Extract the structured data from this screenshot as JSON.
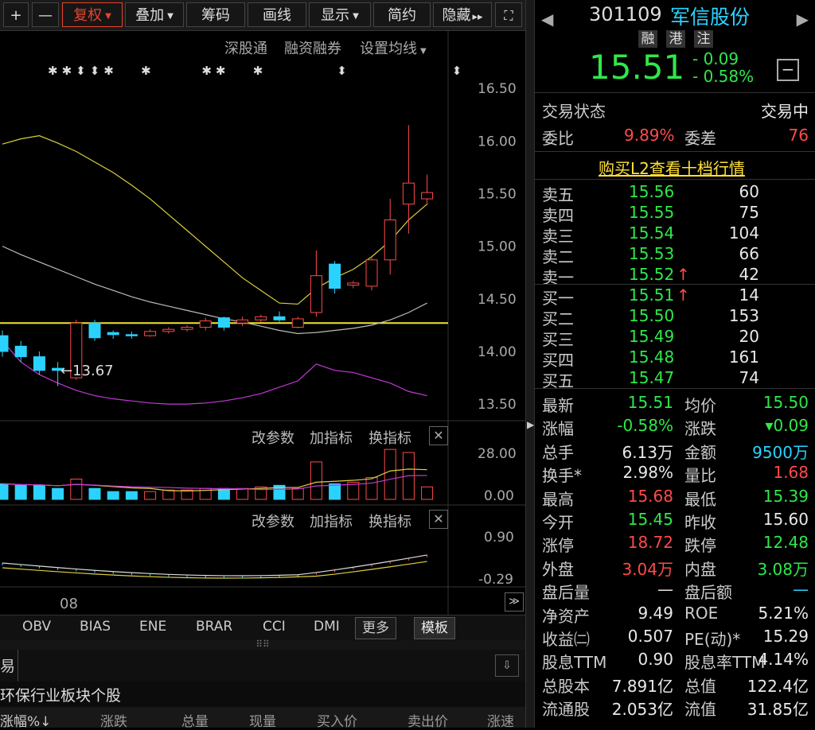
{
  "toolbar": {
    "items": [
      "+",
      "—",
      "复权",
      "叠加",
      "筹码",
      "画线",
      "显示",
      "简约",
      "隐藏"
    ],
    "hide_suffix": "▸▸"
  },
  "chart_links": {
    "sgt": "深股通",
    "rzrq": "融资融券",
    "ma_setting": "设置均线"
  },
  "price_axis": [
    "16.50",
    "16.00",
    "15.50",
    "15.00",
    "14.50",
    "14.00",
    "13.50"
  ],
  "low_marker": "13.67",
  "indicator1": {
    "axis": [
      "28.00",
      "0.00"
    ],
    "buttons": [
      "改参数",
      "加指标",
      "换指标"
    ]
  },
  "indicator2": {
    "axis": [
      "0.90",
      "-0.29"
    ],
    "buttons": [
      "改参数",
      "加指标",
      "换指标"
    ]
  },
  "date_label": "08",
  "bottom_tabs": [
    "OBV",
    "BIAS",
    "ENE",
    "BRAR",
    "CCI",
    "DMI"
  ],
  "bottom_more": "更多",
  "bottom_template": "模板",
  "tab_partial": "易",
  "list_title": "环保行业板块个股",
  "list_headers": [
    "涨幅%↓",
    "涨跌",
    "总量",
    "现量",
    "买入价",
    "卖出价",
    "涨速"
  ],
  "stock": {
    "code": "301109",
    "name": "军信股份",
    "tags": [
      "融",
      "港",
      "注"
    ],
    "price": "15.51",
    "change": "- 0.09",
    "change_pct": "- 0.58%"
  },
  "status": {
    "label": "交易状态",
    "value": "交易中"
  },
  "weibi": {
    "label1": "委比",
    "value1": "9.89%",
    "label2": "委差",
    "value2": "76"
  },
  "l2_link": "购买L2查看十档行情",
  "asks": [
    {
      "label": "卖五",
      "price": "15.56",
      "vol": "60",
      "arrow": ""
    },
    {
      "label": "卖四",
      "price": "15.55",
      "vol": "75",
      "arrow": ""
    },
    {
      "label": "卖三",
      "price": "15.54",
      "vol": "104",
      "arrow": ""
    },
    {
      "label": "卖二",
      "price": "15.53",
      "vol": "66",
      "arrow": ""
    },
    {
      "label": "卖一",
      "price": "15.52",
      "vol": "42",
      "arrow": "↑"
    }
  ],
  "bids": [
    {
      "label": "买一",
      "price": "15.51",
      "vol": "14",
      "arrow": "↑"
    },
    {
      "label": "买二",
      "price": "15.50",
      "vol": "153",
      "arrow": ""
    },
    {
      "label": "买三",
      "price": "15.49",
      "vol": "20",
      "arrow": ""
    },
    {
      "label": "买四",
      "price": "15.48",
      "vol": "161",
      "arrow": ""
    },
    {
      "label": "买五",
      "price": "15.47",
      "vol": "74",
      "arrow": ""
    }
  ],
  "stats": [
    {
      "l1": "最新",
      "v1": "15.51",
      "c1": "green",
      "l2": "均价",
      "v2": "15.50",
      "c2": "green"
    },
    {
      "l1": "涨幅",
      "v1": "-0.58%",
      "c1": "green",
      "l2": "涨跌",
      "v2": "▾0.09",
      "c2": "green"
    },
    {
      "l1": "总手",
      "v1": "6.13万",
      "c1": "white",
      "l2": "金额",
      "v2": "9500万",
      "c2": "cyan"
    },
    {
      "l1": "换手*",
      "v1": "2.98%",
      "c1": "white",
      "l2": "量比",
      "v2": "1.68",
      "c2": "red"
    },
    {
      "l1": "最高",
      "v1": "15.68",
      "c1": "red",
      "l2": "最低",
      "v2": "15.39",
      "c2": "green"
    },
    {
      "l1": "今开",
      "v1": "15.45",
      "c1": "green",
      "l2": "昨收",
      "v2": "15.60",
      "c2": "white"
    },
    {
      "l1": "涨停",
      "v1": "18.72",
      "c1": "red",
      "l2": "跌停",
      "v2": "12.48",
      "c2": "green"
    },
    {
      "l1": "外盘",
      "v1": "3.04万",
      "c1": "red",
      "l2": "内盘",
      "v2": "3.08万",
      "c2": "green"
    },
    {
      "l1": "盘后量",
      "v1": "—",
      "c1": "white",
      "l2": "盘后额",
      "v2": "—",
      "c2": "cyan"
    },
    {
      "l1": "净资产",
      "v1": "9.49",
      "c1": "white",
      "l2": "ROE",
      "v2": "5.21%",
      "c2": "white"
    },
    {
      "l1": "收益㈡",
      "v1": "0.507",
      "c1": "white",
      "l2": "PE(动)*",
      "v2": "15.29",
      "c2": "white"
    },
    {
      "l1": "股息TTM",
      "v1": "0.90",
      "c1": "white",
      "l2": "股息率TTM",
      "v2": "4.14%",
      "c2": "white"
    },
    {
      "l1": "总股本",
      "v1": "7.891亿",
      "c1": "white",
      "l2": "总值",
      "v2": "122.4亿",
      "c2": "white"
    },
    {
      "l1": "流通股",
      "v1": "2.053亿",
      "c1": "white",
      "l2": "流值",
      "v2": "31.85亿",
      "c2": "white"
    }
  ],
  "chart_data": {
    "type": "candlestick",
    "ylim": [
      13.35,
      16.75
    ],
    "reference_line": 14.27,
    "candles": [
      {
        "o": 14.15,
        "c": 14.0,
        "h": 14.2,
        "l": 13.95
      },
      {
        "o": 14.05,
        "c": 13.95,
        "h": 14.1,
        "l": 13.9
      },
      {
        "o": 13.95,
        "c": 13.82,
        "h": 14.0,
        "l": 13.78
      },
      {
        "o": 13.84,
        "c": 13.82,
        "h": 13.9,
        "l": 13.67
      },
      {
        "o": 13.75,
        "c": 14.27,
        "h": 14.3,
        "l": 13.73
      },
      {
        "o": 14.27,
        "c": 14.13,
        "h": 14.3,
        "l": 14.1
      },
      {
        "o": 14.18,
        "c": 14.16,
        "h": 14.2,
        "l": 14.12
      },
      {
        "o": 14.16,
        "c": 14.15,
        "h": 14.19,
        "l": 14.12
      },
      {
        "o": 14.15,
        "c": 14.19,
        "h": 14.21,
        "l": 14.14
      },
      {
        "o": 14.19,
        "c": 14.21,
        "h": 14.23,
        "l": 14.17
      },
      {
        "o": 14.21,
        "c": 14.23,
        "h": 14.25,
        "l": 14.19
      },
      {
        "o": 14.23,
        "c": 14.29,
        "h": 14.32,
        "l": 14.2
      },
      {
        "o": 14.32,
        "c": 14.23,
        "h": 14.33,
        "l": 14.2
      },
      {
        "o": 14.27,
        "c": 14.3,
        "h": 14.33,
        "l": 14.24
      },
      {
        "o": 14.3,
        "c": 14.33,
        "h": 14.35,
        "l": 14.28
      },
      {
        "o": 14.33,
        "c": 14.3,
        "h": 14.38,
        "l": 14.28
      },
      {
        "o": 14.23,
        "c": 14.31,
        "h": 14.33,
        "l": 14.22
      },
      {
        "o": 14.37,
        "c": 14.72,
        "h": 14.96,
        "l": 14.33
      },
      {
        "o": 14.83,
        "c": 14.6,
        "h": 14.86,
        "l": 14.55
      },
      {
        "o": 14.63,
        "c": 14.65,
        "h": 14.67,
        "l": 14.6
      },
      {
        "o": 14.62,
        "c": 14.87,
        "h": 14.89,
        "l": 14.58
      },
      {
        "o": 14.87,
        "c": 15.25,
        "h": 15.45,
        "l": 14.73
      },
      {
        "o": 15.4,
        "c": 15.6,
        "h": 16.15,
        "l": 15.12
      },
      {
        "o": 15.45,
        "c": 15.51,
        "h": 15.68,
        "l": 15.39
      }
    ],
    "ma_yellow": [
      15.97,
      16.02,
      16.05,
      15.98,
      15.9,
      15.8,
      15.7,
      15.58,
      15.45,
      15.3,
      15.15,
      15.0,
      14.85,
      14.7,
      14.58,
      14.46,
      14.45,
      14.6,
      14.7,
      14.78,
      14.9,
      15.05,
      15.25,
      15.4
    ],
    "ma_gray": [
      15.0,
      14.92,
      14.85,
      14.78,
      14.71,
      14.64,
      14.58,
      14.52,
      14.47,
      14.43,
      14.39,
      14.35,
      14.31,
      14.28,
      14.24,
      14.2,
      14.17,
      14.18,
      14.2,
      14.22,
      14.25,
      14.3,
      14.37,
      14.46
    ],
    "ma_purple": [
      14.1,
      13.9,
      13.78,
      13.7,
      13.63,
      13.58,
      13.55,
      13.53,
      13.51,
      13.5,
      13.5,
      13.51,
      13.53,
      13.56,
      13.6,
      13.66,
      13.72,
      13.88,
      13.82,
      13.8,
      13.75,
      13.7,
      13.62,
      13.58
    ],
    "volume_ylim": [
      0,
      28
    ],
    "volume": [
      10,
      9,
      9,
      7,
      13,
      7,
      5,
      5,
      5,
      6,
      6,
      7,
      7,
      7,
      8,
      9,
      7,
      24,
      10,
      11,
      14,
      32,
      30,
      8
    ],
    "macd_ylim": [
      -0.29,
      0.9
    ]
  }
}
